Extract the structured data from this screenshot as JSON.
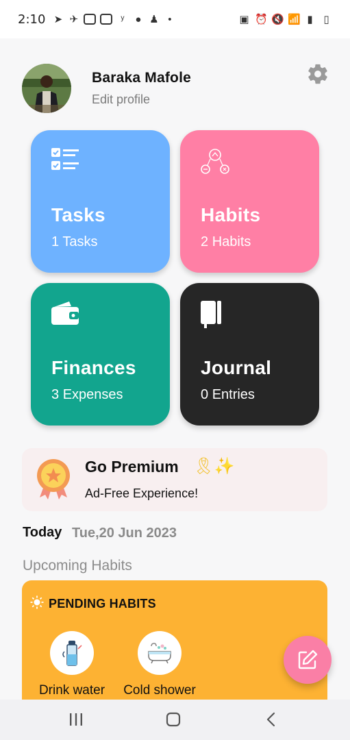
{
  "status_bar": {
    "time": "2:10"
  },
  "profile": {
    "name": "Baraka Mafole",
    "edit_label": "Edit profile"
  },
  "cards": {
    "tasks": {
      "title": "Tasks",
      "count": "1",
      "unit": "Tasks",
      "color": "#6eb2ff"
    },
    "habits": {
      "title": "Habits",
      "count": "2",
      "unit": "Habits",
      "color": "#ff7fa5"
    },
    "finances": {
      "title": "Finances",
      "count": "3",
      "unit": "Expenses",
      "color": "#12a58e"
    },
    "journal": {
      "title": "Journal",
      "count": "0",
      "unit": "Entries",
      "color": "#262626"
    }
  },
  "premium": {
    "title": "Go Premium",
    "emoji": "🎗✨",
    "subtitle": "Ad-Free Experience!"
  },
  "today": {
    "label": "Today",
    "date": "Tue,20 Jun 2023"
  },
  "upcoming_label": "Upcoming Habits",
  "pending": {
    "title": "PENDING HABITS",
    "color": "#fdb233",
    "habits": [
      {
        "name": "Drink water",
        "icon": "water-bottle-icon"
      },
      {
        "name": "Cold shower",
        "icon": "bathtub-icon"
      }
    ]
  },
  "fab": {
    "icon": "edit-note-icon",
    "color": "#fa7fa6"
  },
  "nav": {
    "icons": [
      "recents-icon",
      "home-icon",
      "back-icon"
    ]
  }
}
